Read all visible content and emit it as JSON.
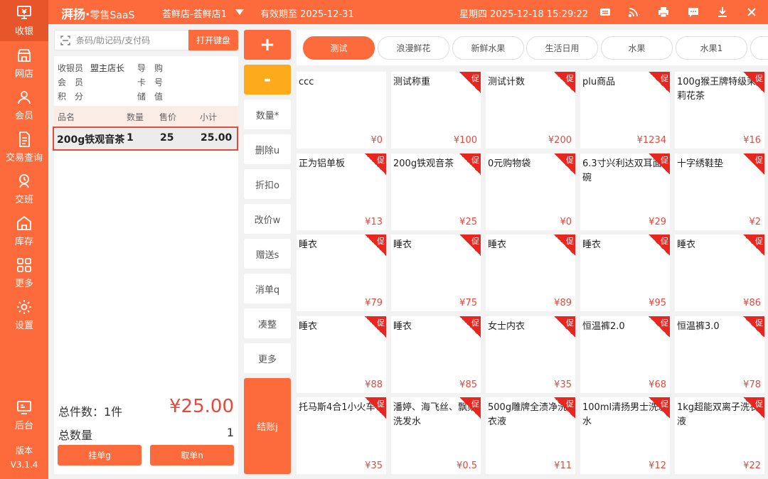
{
  "colors": {
    "accent": "#fd6a3c",
    "warn": "#fdab1a",
    "price": "#e8473a"
  },
  "sidebar": {
    "items": [
      {
        "label": "收银",
        "icon": "cashier-icon"
      },
      {
        "label": "网店",
        "icon": "online-store-icon"
      },
      {
        "label": "会员",
        "icon": "member-icon"
      },
      {
        "label": "交易查询",
        "icon": "transaction-icon"
      },
      {
        "label": "交班",
        "icon": "shift-icon"
      },
      {
        "label": "库存",
        "icon": "inventory-icon"
      },
      {
        "label": "更多",
        "icon": "more-grid-icon"
      },
      {
        "label": "设置",
        "icon": "settings-icon"
      },
      {
        "label": "后台",
        "icon": "backend-icon"
      }
    ],
    "version_label": "版本",
    "version": "V3.1.4"
  },
  "header": {
    "brand": "湃扬·",
    "brand_sub": "零售SaaS",
    "store": "荟鲜店-荟鲜店1",
    "expiry": "有效期至 2025-12-31",
    "datetime": "星期四 2025-12-18 15:29:22"
  },
  "cart": {
    "scan_placeholder": "条码/助记码/支付码",
    "keyboard_btn": "打开键盘",
    "info": {
      "cashier_label": "收银员",
      "cashier_value": "盟主店长",
      "guide_label": "导　购",
      "guide_value": "",
      "member_label": "会　员",
      "member_value": "",
      "card_label": "卡　号",
      "card_value": "",
      "points_label": "积　分",
      "points_value": "",
      "balance_label": "储　值",
      "balance_value": ""
    },
    "columns": [
      "品名",
      "数量",
      "售价",
      "小计"
    ],
    "rows": [
      {
        "name": "200g铁观音茶",
        "qty": "1",
        "price": "25",
        "subtotal": "25.00"
      }
    ],
    "total_items_label": "总件数：1件",
    "total_amount": "¥25.00",
    "total_qty_label": "总数量",
    "total_qty": "1",
    "hold_btn": "挂单g",
    "take_btn": "取单n"
  },
  "actions": {
    "plus": "+",
    "minus": "-",
    "qty": "数量*",
    "delete": "删除u",
    "discount": "折扣o",
    "change_price": "改价w",
    "gift": "赠送s",
    "clear": "消单q",
    "round": "凑整",
    "more": "更多",
    "checkout": "结账j"
  },
  "categories": [
    "测试",
    "浪漫鲜花",
    "新鲜水果",
    "生活日用",
    "水果",
    "水果1"
  ],
  "promo_label": "促",
  "products": [
    {
      "name": "ccc",
      "price": "¥0",
      "promo": false
    },
    {
      "name": "测试称重",
      "price": "¥100",
      "promo": true
    },
    {
      "name": "测试计数",
      "price": "¥200",
      "promo": true
    },
    {
      "name": "plu商品",
      "price": "¥1234",
      "promo": true
    },
    {
      "name": "100g猴王牌特级茉莉花茶",
      "price": "¥16",
      "promo": true
    },
    {
      "name": "正为铝单板",
      "price": "¥13",
      "promo": true
    },
    {
      "name": "200g铁观音茶",
      "price": "¥25",
      "promo": true
    },
    {
      "name": "0元购物袋",
      "price": "¥0",
      "promo": true
    },
    {
      "name": "6.3寸兴利达双耳面碗",
      "price": "¥29",
      "promo": true
    },
    {
      "name": "十字绣鞋垫",
      "price": "¥2",
      "promo": true
    },
    {
      "name": "睡衣",
      "price": "¥79",
      "promo": true
    },
    {
      "name": "睡衣",
      "price": "¥75",
      "promo": true
    },
    {
      "name": "睡衣",
      "price": "¥89",
      "promo": true
    },
    {
      "name": "睡衣",
      "price": "¥95",
      "promo": true
    },
    {
      "name": "睡衣",
      "price": "¥86",
      "promo": true
    },
    {
      "name": "睡衣",
      "price": "¥88",
      "promo": true
    },
    {
      "name": "睡衣",
      "price": "¥85",
      "promo": true
    },
    {
      "name": "女士内衣",
      "price": "¥35",
      "promo": true
    },
    {
      "name": "恒温裤2.0",
      "price": "¥68",
      "promo": true
    },
    {
      "name": "恒温裤3.0",
      "price": "¥78",
      "promo": true
    },
    {
      "name": "托马斯4合1小火车",
      "price": "¥35",
      "promo": true
    },
    {
      "name": "潘婷、海飞丝、飘柔洗发水",
      "price": "¥0.5",
      "promo": true
    },
    {
      "name": "500g雕牌全渍净洗衣液",
      "price": "¥11",
      "promo": true
    },
    {
      "name": "100ml清扬男士洗发水",
      "price": "¥12",
      "promo": true
    },
    {
      "name": "1kg超能双离子洗衣液",
      "price": "¥22",
      "promo": true
    }
  ]
}
